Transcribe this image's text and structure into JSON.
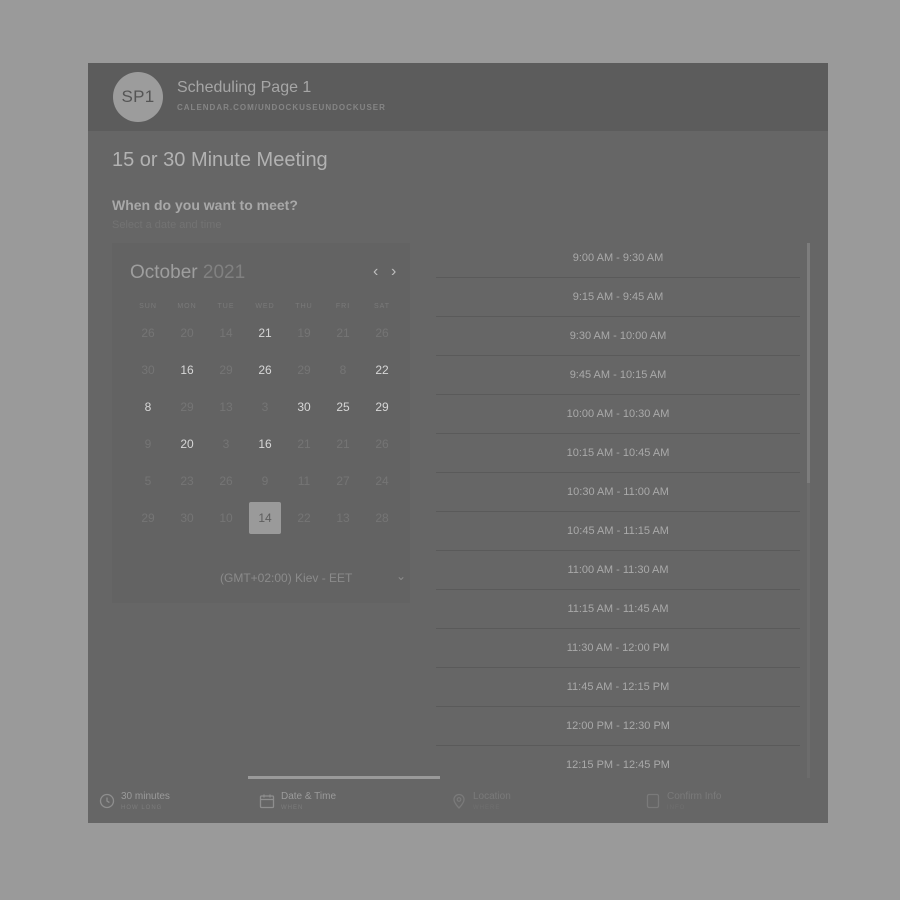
{
  "header": {
    "avatar_initials": "SP1",
    "page_name": "Scheduling Page 1",
    "page_url": "CALENDAR.COM/UNDOCKUSEUNDOCKUSER"
  },
  "meeting": {
    "title": "15 or 30 Minute Meeting",
    "question": "When do you want to meet?",
    "hint": "Select a date and time"
  },
  "calendar": {
    "month": "October",
    "year": "2021",
    "prev_icon": "chevron-left-icon",
    "next_icon": "chevron-right-icon",
    "weekdays": [
      "SUN",
      "MON",
      "TUE",
      "WED",
      "THU",
      "FRI",
      "SAT"
    ],
    "weeks": [
      [
        "26",
        "20",
        "14",
        "21",
        "19",
        "21",
        "26"
      ],
      [
        "30",
        "16",
        "29",
        "26",
        "29",
        "8",
        "22"
      ],
      [
        "8",
        "29",
        "13",
        "3",
        "30",
        "25",
        "29"
      ],
      [
        "9",
        "20",
        "3",
        "16",
        "21",
        "21",
        "26"
      ],
      [
        "5",
        "23",
        "26",
        "9",
        "11",
        "27",
        "24"
      ],
      [
        "29",
        "30",
        "10",
        "14",
        "22",
        "13",
        "28"
      ]
    ],
    "available": [
      [
        3
      ],
      [
        1,
        3,
        6
      ],
      [
        0,
        4,
        5,
        6
      ],
      [
        1,
        3
      ],
      [],
      []
    ],
    "selected": [
      5,
      3
    ],
    "timezone": "(GMT+02:00) Kiev - EET"
  },
  "time_slots": [
    "9:00 AM - 9:30 AM",
    "9:15 AM - 9:45 AM",
    "9:30 AM - 10:00 AM",
    "9:45 AM - 10:15 AM",
    "10:00 AM - 10:30 AM",
    "10:15 AM - 10:45 AM",
    "10:30 AM - 11:00 AM",
    "10:45 AM - 11:15 AM",
    "11:00 AM - 11:30 AM",
    "11:15 AM - 11:45 AM",
    "11:30 AM - 12:00 PM",
    "11:45 AM - 12:15 PM",
    "12:00 PM - 12:30 PM",
    "12:15 PM - 12:45 PM"
  ],
  "steps": [
    {
      "label": "30 minutes",
      "sub": "HOW LONG",
      "icon": "clock-icon"
    },
    {
      "label": "Date & Time",
      "sub": "WHEN",
      "icon": "calendar-icon"
    },
    {
      "label": "Location",
      "sub": "WHERE",
      "icon": "location-pin-icon"
    },
    {
      "label": "Confirm Info",
      "sub": "INFO",
      "icon": "document-icon"
    }
  ],
  "active_step": 1,
  "colors": {
    "overlay_bg": "#9a9a9a",
    "card_bg": "#666666",
    "selected_day": "#9a9a9a"
  }
}
